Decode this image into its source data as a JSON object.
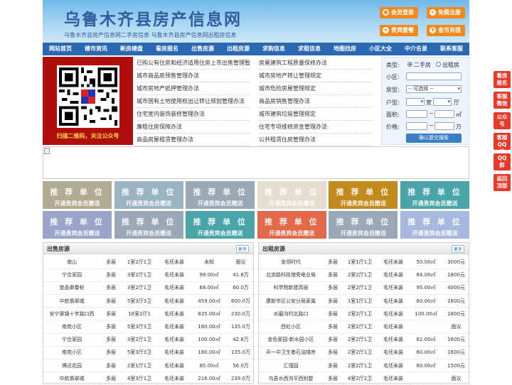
{
  "header": {
    "site_title": "乌鲁木齐县房产信息网",
    "subtitle": "乌鲁木齐县房产信息网二手房信息    乌鲁木齐县房产信息网出租房信息",
    "buttons": [
      "会员登录",
      "免费注册",
      "贵宾套餐",
      "金币充值"
    ]
  },
  "nav": [
    "网站首页",
    "楼市资讯",
    "新房楼盘",
    "看房报名",
    "出售房源",
    "出租房源",
    "求购信息",
    "求租信息",
    "地图找房",
    "小区大全",
    "中介名录",
    "联系客服"
  ],
  "qr": {
    "caption": "扫描二维码，关注公众号"
  },
  "laws": {
    "left": [
      "已购公有住房和经济适用住房上市出售管理暂",
      "城市商品房预售管理办法",
      "城市房地产抵押管理办法",
      "城市国有土地使用权出让转让规划管理办法",
      "住宅室内装饰装修管理办法",
      "廉租住房保障办法",
      "商品房屋租赁管理办法"
    ],
    "right": [
      "房屋建筑工程质量保修办法",
      "城市房地产转让管理规定",
      "城市危险房屋管理规定",
      "商品房销售管理办法",
      "城市建筑垃圾管理规定",
      "住宅专项维修资金管理办法",
      "公共租赁住房管理办法"
    ]
  },
  "search": {
    "type_label": "类型:",
    "type_options": [
      "二手房",
      "出租房"
    ],
    "community_label": "小区:",
    "house_type_label": "房型:",
    "house_type_value": "-- 可选择 --",
    "layout_label": "户型:",
    "room_unit": "室",
    "hall_unit": "厅",
    "area_label": "面积:",
    "area_unit": "㎡",
    "price_label": "价格:",
    "price_unit": "万",
    "submit_label": "确认提交搜索"
  },
  "recommend": {
    "title": "推 荐 单 位",
    "subtitle": "开通贵宾会员赠送",
    "colors": [
      "#b2ab93",
      "#9bb4c3",
      "#9aa9b3",
      "#e4ddd0",
      "#c28a1d",
      "#4aa5a8",
      "#9aa5c9",
      "#9aa8b8",
      "#4aa5a8",
      "#e2694a",
      "#9aa8b8",
      "#a9b8de"
    ]
  },
  "sale": {
    "title": "出售房源",
    "more": "更多",
    "rows": [
      [
        "南山",
        "多层",
        "1室2厅1卫",
        "毛坯未装",
        "未知",
        "面议"
      ],
      [
        "宁合家园",
        "多层",
        "3室2厅1卫",
        "毛坯未装",
        "99.00㎡",
        "41.8万"
      ],
      [
        "宜品渠春秋",
        "多层",
        "3室2厅1卫",
        "毛坯未装",
        "68.00㎡",
        "60.0万"
      ],
      [
        "中航翡翠城",
        "多层",
        "5室3厅3卫",
        "毛坯未装",
        "459.00㎡",
        "600.0万"
      ],
      [
        "安宁渠镇十字路口西",
        "多层",
        "18室2厅1",
        "毛坯未装",
        "835.00㎡",
        "230.0万"
      ],
      [
        "南苑小区",
        "多层",
        "5室3厅3卫",
        "毛坯未装",
        "180.00㎡",
        "135.0万"
      ],
      [
        "宁合家园",
        "多层",
        "3室2厅1卫",
        "毛坯未装",
        "100.00㎡",
        "42.8万"
      ],
      [
        "南苑小区",
        "多层",
        "5室3厅3卫",
        "毛坯未装",
        "180.00㎡",
        "135.0万"
      ],
      [
        "博达花园",
        "多层",
        "2室1厅1卫",
        "毛坯未装",
        "85.00㎡",
        "56.0万"
      ],
      [
        "中航翡翠城",
        "多层",
        "4室3厅1卫",
        "毛坯未装",
        "216.00㎡",
        "239.0万"
      ]
    ]
  },
  "rent": {
    "title": "出租房源",
    "more": "更多",
    "rows": [
      [
        "金领时代",
        "多层",
        "1室1厅1卫",
        "毛坯未装",
        "50.00㎡",
        "3000元"
      ],
      [
        "北京路科技馆旁电业局",
        "多层",
        "2室2厅1卫",
        "毛坯未装",
        "84.00㎡",
        "1800元"
      ],
      [
        "科学院新建高层",
        "多层",
        "2室2厅1卫",
        "毛坯未装",
        "95.00㎡",
        "4000元"
      ],
      [
        "康新市区公安分局家属",
        "多层",
        "1室1厅1卫",
        "毛坯未装",
        "60.00㎡",
        "1600元"
      ],
      [
        "水磨沟村北路口",
        "多层",
        "2室2厅1卫",
        "毛坯未装",
        "100.00㎡",
        "1800元"
      ],
      [
        "西虹小区",
        "多层",
        "2室2厅1卫",
        "毛坯未装",
        "",
        "面议"
      ],
      [
        "金色家园·新水园小区",
        "多层",
        "2室2厅1卫",
        "毛坯未装",
        "82.00㎡",
        "1600元"
      ],
      [
        "兵一中卫生巷石油煤房",
        "多层",
        "2室2厅1卫",
        "毛坯未装",
        "60.00㎡",
        "1600元"
      ],
      [
        "汇瑾园",
        "多层",
        "2室2厅1卫",
        "毛坯未装",
        "60.00㎡",
        "1500元"
      ],
      [
        "乌县水西沟平西别墅",
        "多层",
        "4室2厅2卫",
        "毛坯未装",
        "",
        "面议"
      ]
    ]
  },
  "side": [
    "看房报名",
    "客服微信",
    "公众号",
    "客服QQ号",
    "QQ群",
    "返回顶部"
  ]
}
